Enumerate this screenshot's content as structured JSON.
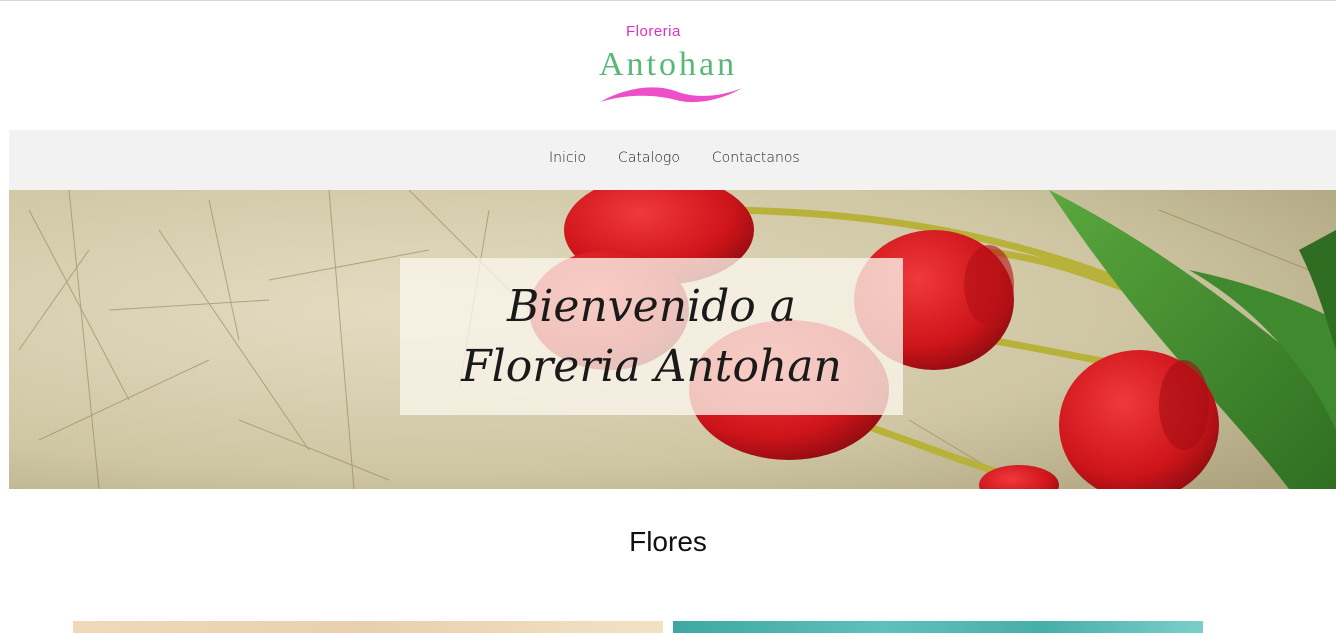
{
  "logo": {
    "small_text": "Floreria",
    "big_text": "Antohan",
    "colors": {
      "small": "#e02fc2",
      "big": "#58b878",
      "swoosh": "#ec4fc7"
    }
  },
  "nav": {
    "items": [
      {
        "label": "Inicio"
      },
      {
        "label": "Catalogo"
      },
      {
        "label": "Contactanos"
      }
    ]
  },
  "hero": {
    "title": "Bienvenido a Floreria Antohan",
    "image": "red-tulips-on-textured-paper"
  },
  "section": {
    "title": "Flores"
  },
  "colors": {
    "nav_bg": "#f2f2f2",
    "tulip_red": "#d4161c"
  }
}
